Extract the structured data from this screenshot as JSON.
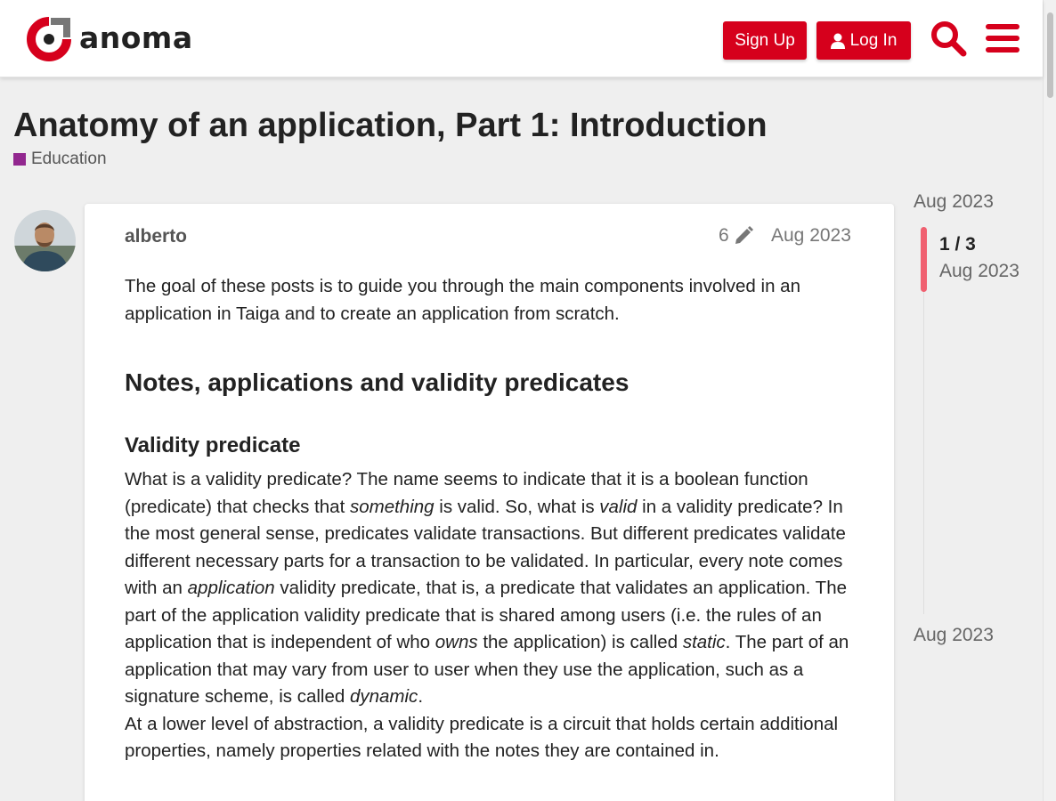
{
  "header": {
    "logo_text": "anoma",
    "signup_label": "Sign Up",
    "login_label": "Log In",
    "brand_color": "#d6001c"
  },
  "topic": {
    "title": "Anatomy of an application, Part 1: Introduction",
    "category": "Education",
    "category_color": "#92278f"
  },
  "post": {
    "username": "alberto",
    "edit_count": "6",
    "date": "Aug 2023",
    "intro": "The goal of these posts is to guide you through the main components involved in an application in Taiga and to create an application from scratch.",
    "heading": "Notes, applications and validity predicates",
    "subheading": "Validity predicate",
    "para2": [
      {
        "t": "What is a validity predicate? The name seems to indicate that it is a boolean function (predicate) that checks that ",
        "em": false
      },
      {
        "t": "something",
        "em": true
      },
      {
        "t": " is valid. So, what is ",
        "em": false
      },
      {
        "t": "valid",
        "em": true
      },
      {
        "t": " in a validity predicate? In the most general sense, predicates validate transactions. But different predicates validate different necessary parts for a transaction to be validated. In particular, every note comes with an ",
        "em": false
      },
      {
        "t": "application",
        "em": true
      },
      {
        "t": " validity predicate, that is, a predicate that validates an application. The part of the application validity predicate that is shared among users (i.e. the rules of an application that is independent of who ",
        "em": false
      },
      {
        "t": "owns",
        "em": true
      },
      {
        "t": " the application) is called ",
        "em": false
      },
      {
        "t": "static",
        "em": true
      },
      {
        "t": ". The part of an application that may vary from user to user when they use the application, such as a signature scheme, is called ",
        "em": false
      },
      {
        "t": "dynamic",
        "em": true
      },
      {
        "t": ".",
        "em": false
      }
    ],
    "para3": "At a lower level of abstraction, a validity predicate is a circuit that holds certain additional properties, namely properties related with the notes they are contained in."
  },
  "timeline": {
    "top_date": "Aug 2023",
    "progress": "1 / 3",
    "progress_date": "Aug 2023",
    "bottom_date": "Aug 2023"
  }
}
